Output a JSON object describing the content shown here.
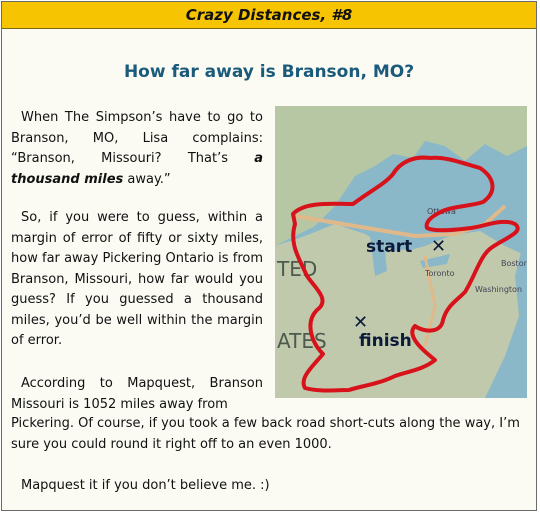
{
  "header": {
    "title": "Crazy Distances, #8"
  },
  "question": "How far away is Branson, MO?",
  "paragraphs": {
    "p1_start": "When The Simpson’s have to go to Branson, MO, Lisa complains: “Branson, Missouri? That’s ",
    "p1_em": "a thousand miles",
    "p1_end": " away.”",
    "p2": "So, if you were to guess, within a margin of error of fifty or sixty miles, how far away Pickering Ontario is from Branson, Missouri, how far would you guess? If you guessed a thousand miles, you’d be well within the margin of error.",
    "p3a": "According to Mapquest, Branson Missouri is 1052 miles away from",
    "p3b": "Pickering. Of course, if you took a few back road short-cuts along the way, I’m sure you could round it right off to an even 1000.",
    "p4": "Mapquest it if you don’t believe me. :)"
  },
  "map": {
    "start_label": "start",
    "finish_label": "finish",
    "place_labels": [
      "Ottawa",
      "Toronto",
      "Boston",
      "Washington",
      "TED",
      "ATES"
    ],
    "colors": {
      "water": "#8ab8c8",
      "land": "#b9c7a6",
      "route": "#d8121b",
      "road": "#e0b98a"
    }
  }
}
